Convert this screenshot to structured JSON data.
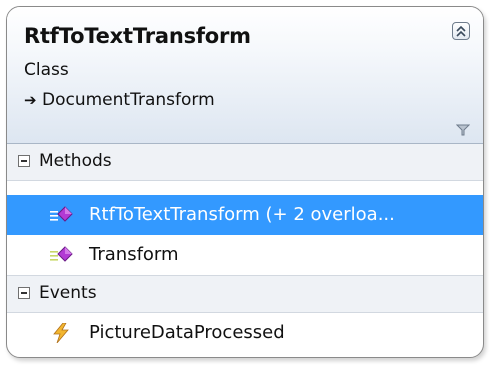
{
  "class_shape": {
    "name": "RtfToTextTransform",
    "kind": "Class",
    "base_class": "DocumentTransform",
    "icons": {
      "collapse": "double-chevron-up-icon",
      "filter": "filter-icon",
      "inheritance": "inheritance-arrow-icon"
    }
  },
  "sections": {
    "methods": {
      "label": "Methods",
      "items": [
        {
          "label": "RtfToTextTransform (+ 2  overloa...",
          "icon": "method-icon",
          "selected": true
        },
        {
          "label": "Transform",
          "icon": "method-icon",
          "selected": false
        }
      ]
    },
    "events": {
      "label": "Events",
      "items": [
        {
          "label": "PictureDataProcessed",
          "icon": "event-lightning-icon",
          "selected": false
        }
      ]
    }
  },
  "colors": {
    "selection": "#3399ff",
    "method_icon": "#b23ad4",
    "event_icon": "#e0a020",
    "header_gradient_end": "#dde6f1"
  },
  "base_arrow_glyph": "➔"
}
